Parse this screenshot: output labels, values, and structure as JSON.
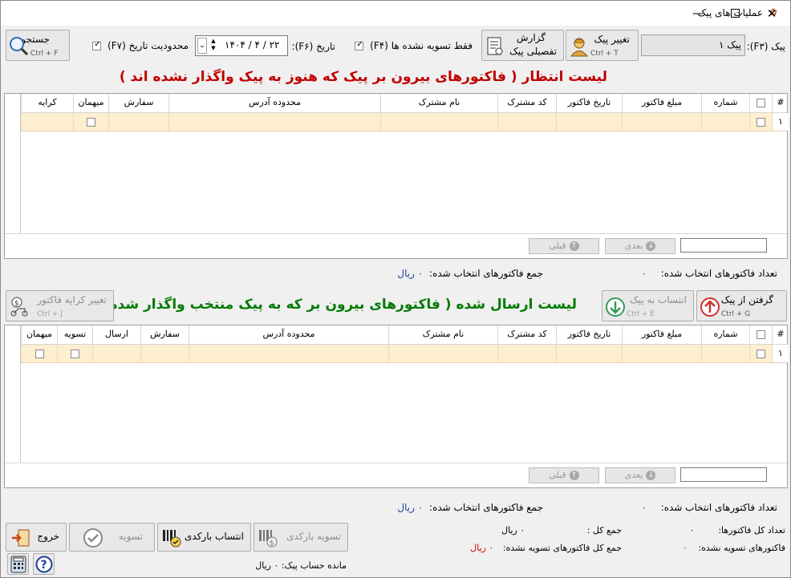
{
  "window": {
    "title": "عملیات های پیک",
    "controls": {
      "minimize": "—",
      "maximize": "☐",
      "close": "✕"
    }
  },
  "toolbar": {
    "courier_label": "پیک (F۳):",
    "courier_value": "پیک ۱",
    "change_courier": {
      "label": "تغییر پیک",
      "shortcut": "Ctrl + T"
    },
    "detailed_report": {
      "label_line1": "گزارش",
      "label_line2": "تفصیلی پیک"
    },
    "only_unsettled": {
      "label": "فقط تسویه نشده ها (F۴)",
      "checked": true
    },
    "date_label": "تاریخ (F۶):",
    "date_value": "۱۴۰۴ / ۴ / ۲۲",
    "date_limit": {
      "label": "محدودیت تاریخ (F۷)",
      "checked": true
    },
    "search": {
      "label": "جستجو",
      "shortcut": "Ctrl + F"
    }
  },
  "pending": {
    "title": "لیست انتظار ( فاکتورهای بیرون بر پیک که هنوز به پیک واگذار نشده اند )",
    "columns": [
      "#",
      "",
      "شماره",
      "مبلغ فاکتور",
      "تاریخ فاکتور",
      "کد مشترک",
      "نام مشترک",
      "محدوده آدرس",
      "سفارش",
      "میهمان",
      "کرایه"
    ],
    "row_number": "۱",
    "nav": {
      "next": "بعدی",
      "prev": "قبلی"
    },
    "summary_count_label": "تعداد فاکتورهای انتخاب شده:",
    "summary_count_value": "۰",
    "summary_sum_label": "جمع فاکتورهای انتخاب شده:",
    "summary_sum_value": "۰ ریال"
  },
  "middle": {
    "take_from_courier": {
      "label": "گرفتن از پیک",
      "shortcut": "Ctrl + G"
    },
    "assign_to_courier": {
      "label": "انتساب به پیک",
      "shortcut": "Ctrl + E"
    },
    "change_fare": {
      "label": "تغییر کرایه فاکتور",
      "shortcut": "Ctrl + J"
    }
  },
  "sent": {
    "title": "لیست ارسال شده ( فاکتورهای بیرون بر که به پیک منتخب واگذار شده اند )",
    "columns": [
      "#",
      "",
      "شماره",
      "مبلغ فاکتور",
      "تاریخ فاکتور",
      "کد مشترک",
      "نام مشترک",
      "محدوده آدرس",
      "سفارش",
      "ارسال",
      "تسویه",
      "میهمان"
    ],
    "row_number": "۱",
    "nav": {
      "next": "بعدی",
      "prev": "قبلی"
    },
    "summary_count_label": "تعداد فاکتورهای انتخاب شده:",
    "summary_count_value": "۰",
    "summary_sum_label": "جمع فاکتورهای انتخاب شده:",
    "summary_sum_value": "۰ ریال"
  },
  "footer": {
    "total_invoices_label": "تعداد کل فاکتورها:",
    "total_invoices_value": "۰",
    "unsettled_invoices_label": "فاکتورهای تسویه نشده:",
    "unsettled_invoices_value": "۰",
    "grand_total_label": "جمع کل :",
    "grand_total_value": "۰ ریال",
    "unsettled_total_label": "جمع کل فاکتورهای تسویه نشده:",
    "unsettled_total_value": "۰ ریال",
    "balance": "مانده حساب پیک: ۰ ریال",
    "buttons": {
      "exit": "خروج",
      "settle": "تسویه",
      "barcode_assign": "انتساب بارکدی",
      "barcode_settle": "تسویه بارکدی"
    }
  },
  "colors": {
    "row_highlight": "#fdefcf",
    "title_red": "#c00000",
    "title_green": "#007a00",
    "value_blue": "#1f3f9f"
  }
}
